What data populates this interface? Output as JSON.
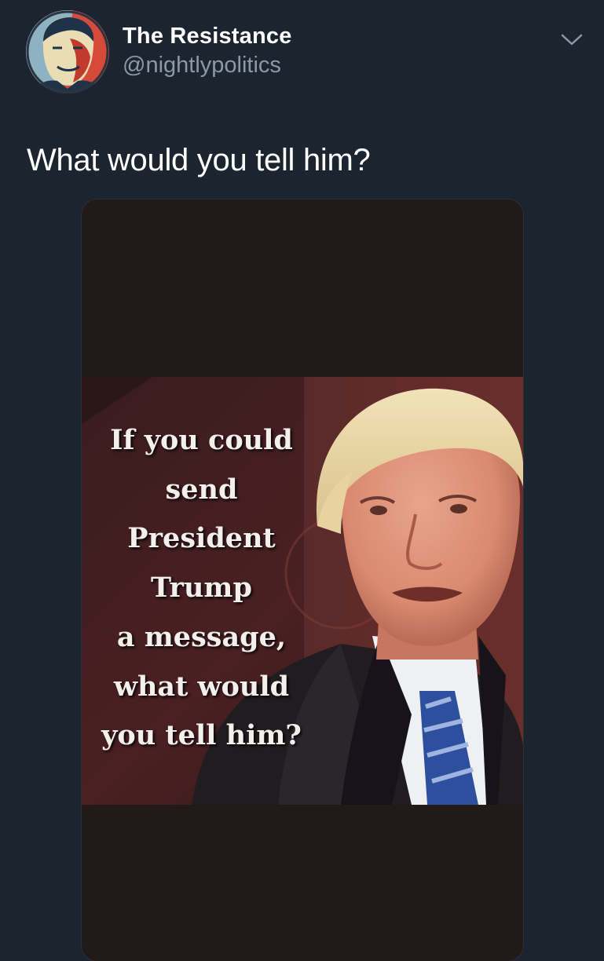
{
  "tweet": {
    "author": {
      "name": "The Resistance",
      "handle": "@nightlypolitics",
      "avatar_icon": "poster-portrait-avatar"
    },
    "caret_icon": "chevron-down-icon",
    "text": "What would you tell him?",
    "media": {
      "meme_lines": [
        "If you could",
        "send",
        "President",
        "Trump",
        "a message,",
        "what would",
        "you tell him?"
      ]
    }
  },
  "colors": {
    "background": "#1c2430",
    "text_primary": "#ffffff",
    "text_secondary": "#8b98a5",
    "media_bg": "#221919"
  }
}
